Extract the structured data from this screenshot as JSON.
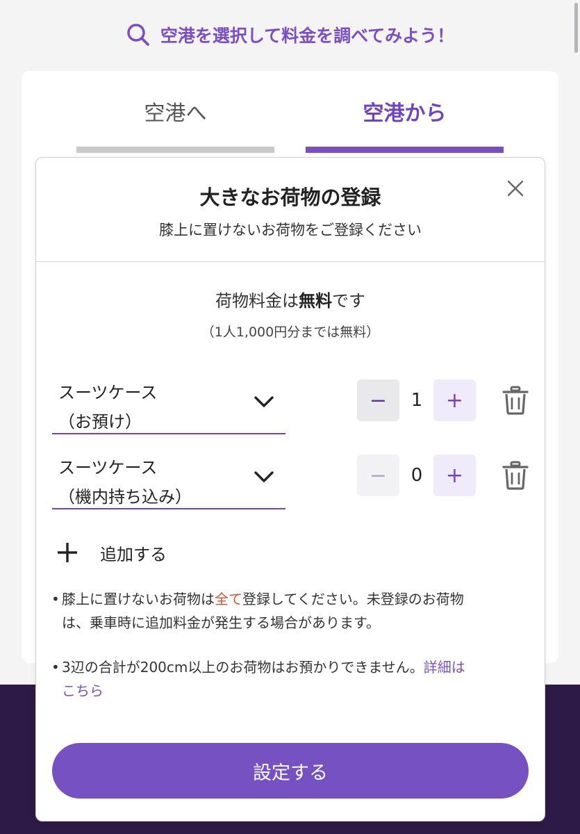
{
  "page": {
    "prompt": "空港を選択して料金を調べてみよう！",
    "accent_color": "#7a4fc4",
    "band_color": "#2e1a47"
  },
  "tabs": [
    {
      "label": "空港へ",
      "active": false
    },
    {
      "label": "空港から",
      "active": true
    }
  ],
  "modal": {
    "title": "大きなお荷物の登録",
    "subtitle": "膝上に置けないお荷物をご登録ください",
    "close_icon": "close-icon",
    "fee_prefix": "荷物料金は",
    "fee_bold": "無料",
    "fee_suffix": "です",
    "fee_note": "（1人1,000円分までは無料）",
    "bags": [
      {
        "line1": "スーツケース",
        "line2": "（お預け）",
        "count": "1",
        "minus_enabled": true
      },
      {
        "line1": "スーツケース",
        "line2": "（機内持ち込み）",
        "count": "0",
        "minus_enabled": false
      }
    ],
    "minus_symbol": "−",
    "plus_symbol": "+",
    "add_label": "追加する",
    "notes": {
      "bullet": "•",
      "note1_a": "膝上に置けないお荷物は",
      "note1_red": "全て",
      "note1_b": "登録してください。未登録のお荷物",
      "note1_c": "は、乗車時に追加料金が発生する場合があります。",
      "note2_a": "3辺の合計が200cm以上のお荷物はお預かりできません。",
      "note2_link_a": "詳細は",
      "note2_link_b": "こちら"
    },
    "submit_label": "設定する"
  }
}
